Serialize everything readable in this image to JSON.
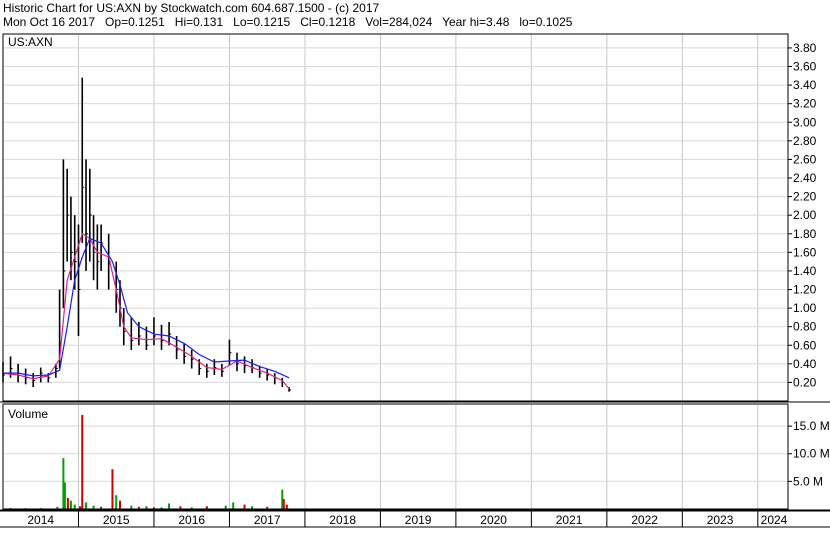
{
  "header": {
    "line1": "Historic Chart for US:AXN by Stockwatch.com 604.687.1500 - (c) 2017",
    "line2": "Mon Oct 16 2017   Op=0.1251   Hi=0.131   Lo=0.1215   Cl=0.1218   Vol=284,024   Year hi=3.48   lo=0.1025"
  },
  "chart_data": [
    {
      "type": "line",
      "title": "US:AXN",
      "description_scale": "price",
      "ylim": [
        0,
        3.95
      ],
      "xlim": [
        2014.0,
        2024.4
      ],
      "grid": true,
      "y_ticks": [
        "3.80",
        "3.60",
        "3.40",
        "3.20",
        "3.00",
        "2.80",
        "2.60",
        "2.40",
        "2.20",
        "2.00",
        "1.80",
        "1.60",
        "1.40",
        "1.20",
        "1.00",
        "0.80",
        "0.60",
        "0.40",
        "0.20"
      ],
      "series": [
        {
          "style": "price-bars",
          "color": "#000000",
          "x": [
            2014.0,
            2014.1,
            2014.2,
            2014.3,
            2014.4,
            2014.5,
            2014.6,
            2014.7,
            2014.75,
            2014.8,
            2014.85,
            2014.9,
            2014.95,
            2015.0,
            2015.05,
            2015.1,
            2015.15,
            2015.2,
            2015.25,
            2015.3,
            2015.4,
            2015.5,
            2015.55,
            2015.6,
            2015.7,
            2015.8,
            2015.9,
            2016.0,
            2016.1,
            2016.2,
            2016.3,
            2016.4,
            2016.5,
            2016.6,
            2016.7,
            2016.8,
            2016.9,
            2017.0,
            2017.1,
            2017.2,
            2017.3,
            2017.4,
            2017.5,
            2017.6,
            2017.7,
            2017.79
          ],
          "y": [
            0.28,
            0.35,
            0.3,
            0.25,
            0.22,
            0.3,
            0.25,
            0.35,
            0.6,
            1.4,
            2.0,
            1.6,
            1.5,
            1.2,
            2.3,
            1.8,
            2.0,
            1.6,
            1.5,
            1.7,
            1.5,
            1.2,
            1.0,
            0.75,
            0.65,
            0.7,
            0.6,
            0.7,
            0.65,
            0.72,
            0.55,
            0.48,
            0.45,
            0.35,
            0.32,
            0.36,
            0.32,
            0.52,
            0.4,
            0.38,
            0.36,
            0.3,
            0.28,
            0.25,
            0.2,
            0.12
          ],
          "hi": [
            0.42,
            0.48,
            0.4,
            0.35,
            0.3,
            0.36,
            0.3,
            0.4,
            1.2,
            2.6,
            2.5,
            2.2,
            2.0,
            1.9,
            3.48,
            2.6,
            2.5,
            2.0,
            1.9,
            1.9,
            1.8,
            1.5,
            1.3,
            1.0,
            0.9,
            0.85,
            0.8,
            0.9,
            0.82,
            0.85,
            0.7,
            0.62,
            0.55,
            0.45,
            0.4,
            0.45,
            0.4,
            0.66,
            0.52,
            0.48,
            0.45,
            0.38,
            0.34,
            0.3,
            0.25,
            0.15
          ],
          "lo": [
            0.2,
            0.25,
            0.2,
            0.18,
            0.15,
            0.2,
            0.2,
            0.25,
            0.35,
            1.0,
            1.5,
            1.3,
            1.2,
            0.7,
            1.7,
            1.4,
            1.5,
            1.3,
            1.2,
            1.4,
            1.2,
            0.95,
            0.8,
            0.6,
            0.55,
            0.6,
            0.55,
            0.6,
            0.55,
            0.6,
            0.45,
            0.4,
            0.35,
            0.28,
            0.25,
            0.28,
            0.26,
            0.38,
            0.32,
            0.3,
            0.3,
            0.25,
            0.22,
            0.18,
            0.15,
            0.1
          ]
        },
        {
          "style": "moving-average-short",
          "color": "#e0208a",
          "x": [
            2014.0,
            2014.2,
            2014.4,
            2014.6,
            2014.75,
            2014.85,
            2014.95,
            2015.05,
            2015.15,
            2015.25,
            2015.4,
            2015.5,
            2015.6,
            2015.7,
            2015.9,
            2016.1,
            2016.3,
            2016.5,
            2016.7,
            2016.9,
            2017.1,
            2017.3,
            2017.5,
            2017.7,
            2017.79
          ],
          "y": [
            0.3,
            0.28,
            0.24,
            0.27,
            0.45,
            1.3,
            1.55,
            1.8,
            1.75,
            1.6,
            1.55,
            1.2,
            0.8,
            0.68,
            0.66,
            0.67,
            0.58,
            0.48,
            0.36,
            0.34,
            0.43,
            0.36,
            0.3,
            0.22,
            0.13
          ]
        },
        {
          "style": "moving-average-long",
          "color": "#1a1aff",
          "x": [
            2014.0,
            2014.2,
            2014.4,
            2014.6,
            2014.75,
            2014.85,
            2014.95,
            2015.05,
            2015.15,
            2015.3,
            2015.45,
            2015.55,
            2015.65,
            2015.8,
            2016.0,
            2016.2,
            2016.4,
            2016.6,
            2016.8,
            2017.0,
            2017.2,
            2017.4,
            2017.6,
            2017.79
          ],
          "y": [
            0.3,
            0.3,
            0.27,
            0.28,
            0.33,
            0.8,
            1.3,
            1.55,
            1.75,
            1.7,
            1.5,
            1.25,
            0.95,
            0.8,
            0.72,
            0.7,
            0.62,
            0.5,
            0.42,
            0.43,
            0.44,
            0.37,
            0.32,
            0.25
          ]
        }
      ]
    },
    {
      "type": "bar",
      "title": "Volume",
      "ylim": [
        0,
        19000000
      ],
      "y_ticks": [
        "15.0 M",
        "10.0 M",
        "5.0 M"
      ],
      "x_ticks": [
        "2014",
        "2015",
        "2016",
        "2017",
        "2018",
        "2019",
        "2020",
        "2021",
        "2022",
        "2023",
        "2024"
      ],
      "x": [
        2014.1,
        2014.3,
        2014.5,
        2014.72,
        2014.8,
        2014.82,
        2014.86,
        2014.9,
        2014.95,
        2015.02,
        2015.05,
        2015.1,
        2015.2,
        2015.3,
        2015.45,
        2015.5,
        2015.55,
        2015.7,
        2015.8,
        2015.9,
        2016.0,
        2016.1,
        2016.2,
        2016.35,
        2016.5,
        2016.7,
        2016.95,
        2017.05,
        2017.2,
        2017.3,
        2017.5,
        2017.7,
        2017.72,
        2017.76
      ],
      "values": [
        200000,
        150000,
        180000,
        400000,
        9200000,
        4800000,
        2000000,
        1500000,
        800000,
        500000,
        17000000,
        1200000,
        600000,
        400000,
        7200000,
        2500000,
        1500000,
        600000,
        400000,
        500000,
        300000,
        300000,
        1000000,
        500000,
        300000,
        500000,
        600000,
        1200000,
        800000,
        500000,
        400000,
        3500000,
        1800000,
        800000
      ],
      "colors": [
        "#00a000",
        "#cc0000",
        "#00a000",
        "#00a000",
        "#00a000",
        "#00a000",
        "#cc0000",
        "#00a000",
        "#00a000",
        "#cc0000",
        "#cc0000",
        "#00a000",
        "#00a000",
        "#cc0000",
        "#cc0000",
        "#00a000",
        "#cc0000",
        "#00a000",
        "#cc0000",
        "#00a000",
        "#cc0000",
        "#00a000",
        "#00a000",
        "#cc0000",
        "#00a000",
        "#cc0000",
        "#00a000",
        "#00a000",
        "#cc0000",
        "#00a000",
        "#cc0000",
        "#00a000",
        "#cc0000",
        "#cc0000"
      ]
    }
  ]
}
